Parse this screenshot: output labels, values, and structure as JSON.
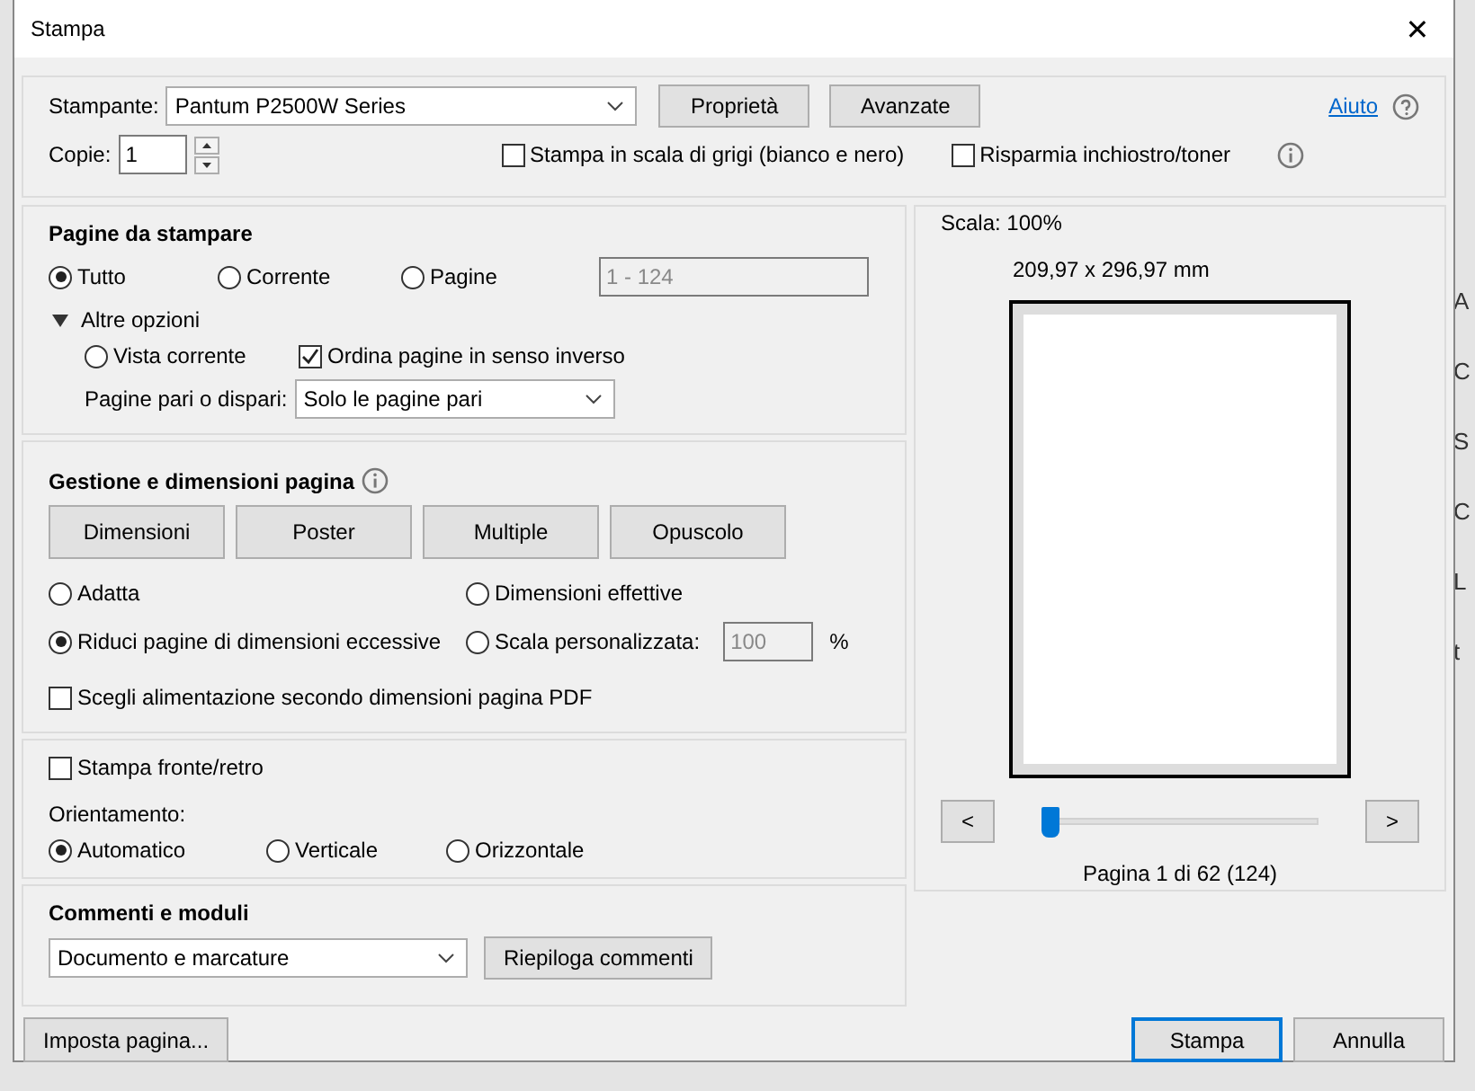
{
  "window": {
    "title": "Stampa",
    "close": "✕"
  },
  "background_fragments": [
    "A",
    "C",
    "S",
    "C",
    "L",
    "t"
  ],
  "printer": {
    "label": "Stampante:",
    "value": "Pantum P2500W Series",
    "buttons": [
      "Proprietà",
      "Avanzate"
    ],
    "help": "Aiuto"
  },
  "copies": {
    "label": "Copie:",
    "value": "1"
  },
  "print_options": [
    {
      "label": "Stampa in scala di grigi (bianco e nero)",
      "checked": false
    },
    {
      "label": "Risparmia inchiostro/toner",
      "checked": false
    }
  ],
  "pages": {
    "title": "Pagine da stampare",
    "options": [
      {
        "label": "Tutto",
        "selected": true
      },
      {
        "label": "Corrente",
        "selected": false
      },
      {
        "label": "Pagine",
        "selected": false
      }
    ],
    "range": "1 - 124",
    "more": {
      "label": "Altre opzioni",
      "expanded": true
    },
    "current_view": {
      "label": "Vista corrente",
      "selected": false
    },
    "reverse": {
      "label": "Ordina pagine in senso inverso",
      "checked": true
    },
    "odd_even": {
      "label": "Pagine pari o dispari:",
      "value": "Solo le pagine pari"
    }
  },
  "handling": {
    "title": "Gestione e dimensioni pagina",
    "modes": [
      {
        "label": "Dimensioni"
      },
      {
        "label": "Poster"
      },
      {
        "label": "Multiple"
      },
      {
        "label": "Opuscolo"
      }
    ],
    "size_options": [
      {
        "label": "Adatta",
        "selected": false
      },
      {
        "label": "Dimensioni effettive",
        "selected": false
      },
      {
        "label": "Riduci pagine di dimensioni eccessive",
        "selected": true
      },
      {
        "label": "Scala personalizzata:",
        "selected": false
      }
    ],
    "scale_value": "100",
    "scale_unit": "%",
    "paper_source": {
      "label": "Scegli alimentazione secondo dimensioni pagina PDF",
      "checked": false
    }
  },
  "duplex": {
    "label": "Stampa fronte/retro",
    "checked": false
  },
  "orientation": {
    "label": "Orientamento:",
    "options": [
      {
        "label": "Automatico",
        "selected": true
      },
      {
        "label": "Verticale",
        "selected": false
      },
      {
        "label": "Orizzontale",
        "selected": false
      }
    ]
  },
  "comments": {
    "title": "Commenti e moduli",
    "value": "Documento e marcature",
    "button": "Riepiloga commenti"
  },
  "preview": {
    "scale": "Scala: 100%",
    "size": "209,97 x 296,97 mm",
    "prev": "<",
    "next": ">",
    "level": 0,
    "page": "Pagina 1 di 62 (124)"
  },
  "footer": {
    "setup": "Imposta pagina...",
    "print": "Stampa",
    "cancel": "Annulla"
  }
}
